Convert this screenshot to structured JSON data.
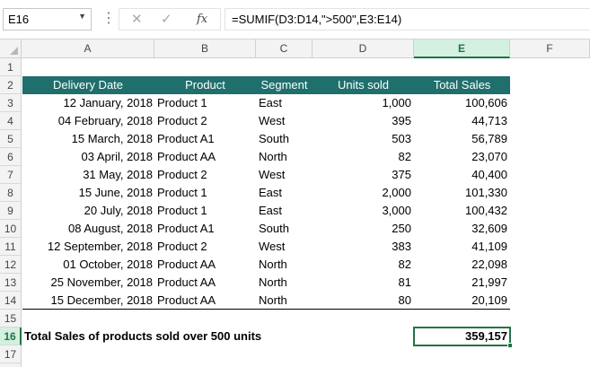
{
  "formula_bar": {
    "name_box": "E16",
    "dots": "⋮",
    "cancel_icon": "✕",
    "enter_icon": "✓",
    "fx_label": "fx",
    "formula": "=SUMIF(D3:D14,\">500\",E3:E14)"
  },
  "columns": [
    "A",
    "B",
    "C",
    "D",
    "E",
    "F"
  ],
  "rows": [
    "1",
    "2",
    "3",
    "4",
    "5",
    "6",
    "7",
    "8",
    "9",
    "10",
    "11",
    "12",
    "13",
    "14",
    "15",
    "16",
    "17"
  ],
  "selected_cell": {
    "column": "E",
    "row": "16"
  },
  "colors": {
    "header_fill": "#1f6f6d",
    "selection": "#217346"
  },
  "table": {
    "headers": [
      "Delivery Date",
      "Product",
      "Segment",
      "Units sold",
      "Total Sales"
    ],
    "rows": [
      [
        "12 January, 2018",
        "Product 1",
        "East",
        "1,000",
        "100,606"
      ],
      [
        "04 February, 2018",
        "Product 2",
        "West",
        "395",
        "44,713"
      ],
      [
        "15 March, 2018",
        "Product A1",
        "South",
        "503",
        "56,789"
      ],
      [
        "03 April, 2018",
        "Product AA",
        "North",
        "82",
        "23,070"
      ],
      [
        "31 May, 2018",
        "Product 2",
        "West",
        "375",
        "40,400"
      ],
      [
        "15 June, 2018",
        "Product 1",
        "East",
        "2,000",
        "101,330"
      ],
      [
        "20 July, 2018",
        "Product 1",
        "East",
        "3,000",
        "100,432"
      ],
      [
        "08 August, 2018",
        "Product A1",
        "South",
        "250",
        "32,609"
      ],
      [
        "12 September, 2018",
        "Product 2",
        "West",
        "383",
        "41,109"
      ],
      [
        "01 October, 2018",
        "Product AA",
        "North",
        "82",
        "22,098"
      ],
      [
        "25 November, 2018",
        "Product AA",
        "North",
        "81",
        "21,997"
      ],
      [
        "15 December, 2018",
        "Product AA",
        "North",
        "80",
        "20,109"
      ]
    ]
  },
  "summary": {
    "label": "Total Sales of products sold over 500 units",
    "value": "359,157"
  }
}
